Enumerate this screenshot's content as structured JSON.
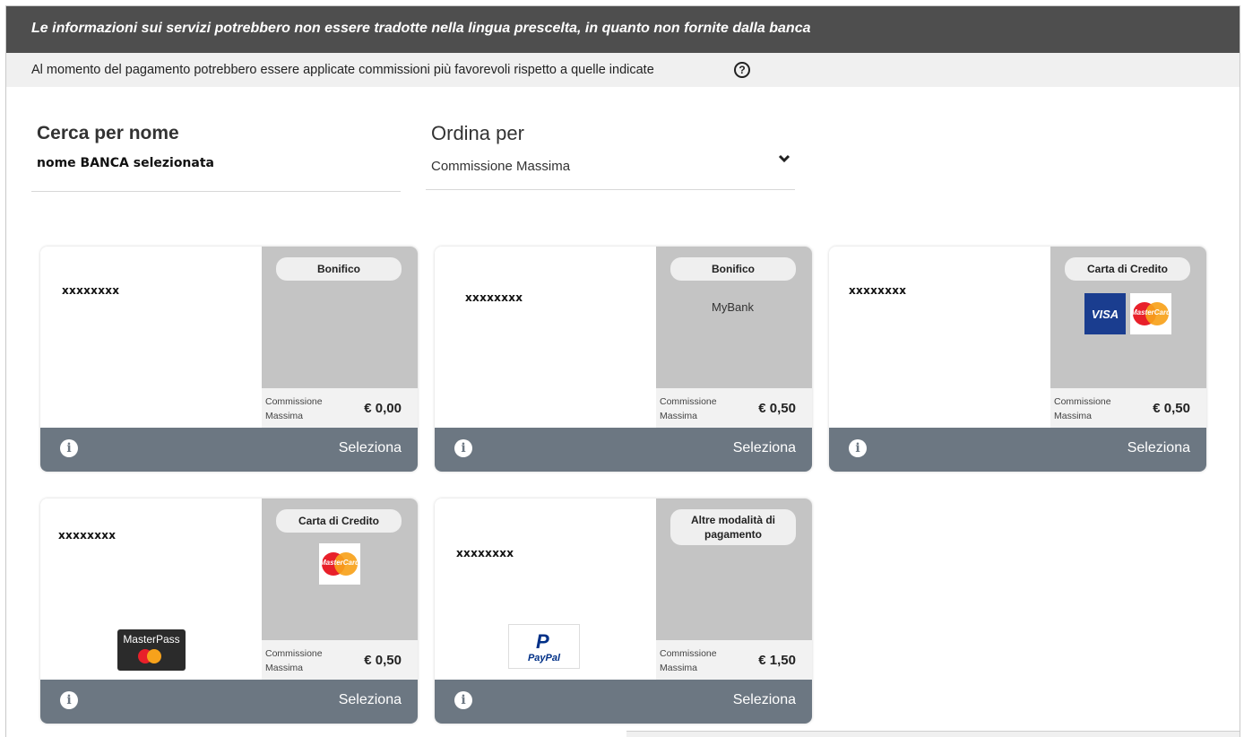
{
  "banner": {
    "warning": "Le informazioni sui servizi potrebbero non essere tradotte nella lingua prescelta, in quanto non fornite dalla banca",
    "note": "Al momento del pagamento potrebbero essere applicate commissioni più favorevoli rispetto a quelle indicate",
    "help_icon": "?"
  },
  "search": {
    "title": "Cerca per nome",
    "value": "nome BANCA selezionata"
  },
  "sort": {
    "title": "Ordina per",
    "value": "Commissione Massima"
  },
  "cards": [
    {
      "bank": "xxxxxxxx",
      "type": "Bonifico",
      "fee_label": "Commissione Massima",
      "fee": "€ 0,00",
      "action": "Seleziona",
      "logos": []
    },
    {
      "bank": "xxxxxxxx",
      "type": "Bonifico",
      "fee_label": "Commissione Massima",
      "fee": "€ 0,50",
      "action": "Seleziona",
      "logos": [
        "MyBank"
      ]
    },
    {
      "bank": "xxxxxxxx",
      "type": "Carta di Credito",
      "fee_label": "Commissione Massima",
      "fee": "€ 0,50",
      "action": "Seleziona",
      "logos": [
        "VISA",
        "MasterCard"
      ]
    },
    {
      "bank": "xxxxxxxx",
      "type": "Carta di Credito",
      "fee_label": "Commissione Massima",
      "fee": "€ 0,50",
      "action": "Seleziona",
      "logos": [
        "MasterCard",
        "MasterPass"
      ]
    },
    {
      "bank": "xxxxxxxx",
      "type": "Altre modalità di pagamento",
      "fee_label": "Commissione Massima",
      "fee": "€ 1,50",
      "action": "Seleziona",
      "logos": [
        "PayPal"
      ]
    }
  ],
  "icons": {
    "info": "info-icon",
    "chevron": "chevron-down-icon",
    "help": "question-circle-icon"
  },
  "colors": {
    "topbar": "#4e4e4e",
    "footer": "#6c7782",
    "panel": "#c4c4c4"
  }
}
